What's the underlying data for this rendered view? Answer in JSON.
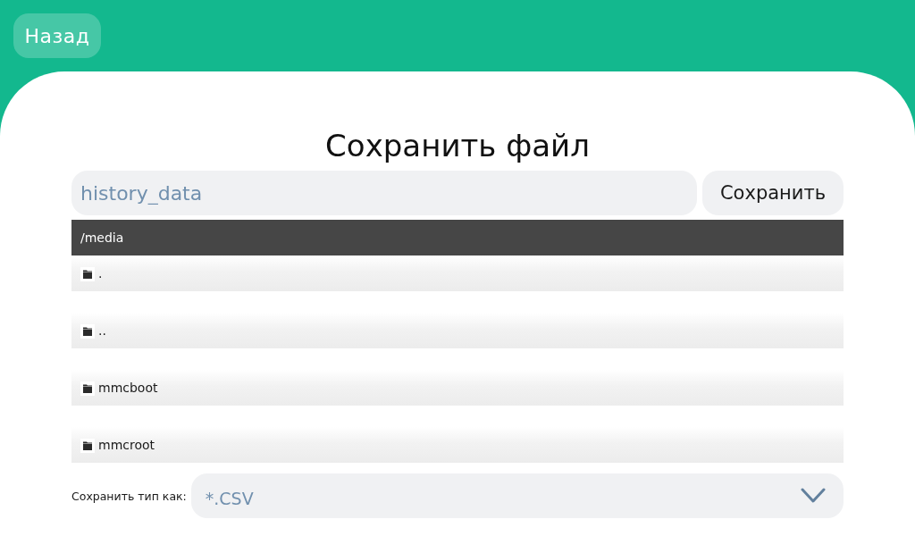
{
  "header": {
    "back_button": "Назад"
  },
  "dialog": {
    "title": "Сохранить файл",
    "filename": {
      "value": "history_data"
    },
    "save_button": "Сохранить",
    "path": "/media",
    "entries": [
      {
        "name": "."
      },
      {
        "name": ".."
      },
      {
        "name": "mmcboot"
      },
      {
        "name": "mmcroot"
      }
    ],
    "file_type": {
      "label": "Сохранить тип как:",
      "value": "*.CSV"
    }
  }
}
